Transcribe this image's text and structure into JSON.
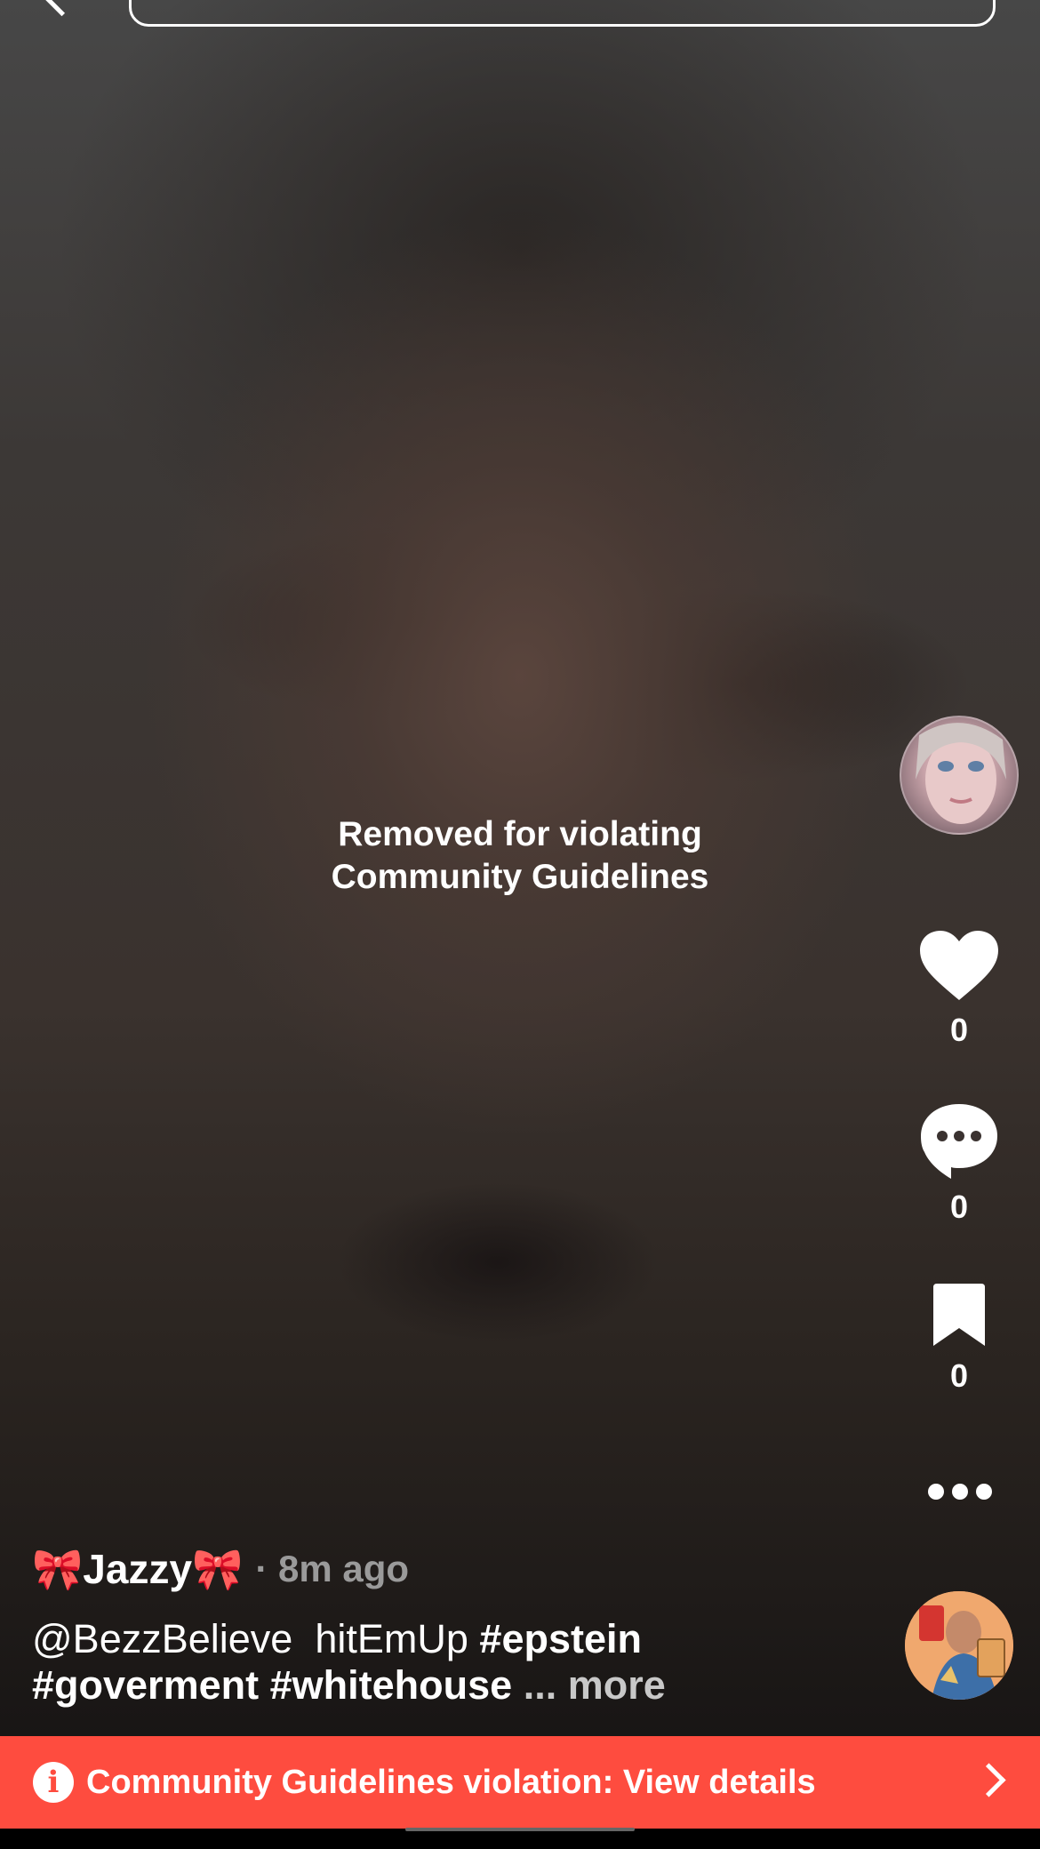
{
  "removed_notice": {
    "line1": "Removed for violating",
    "line2": "Community Guidelines"
  },
  "side_rail": {
    "like_count": "0",
    "comment_count": "0",
    "bookmark_count": "0"
  },
  "post": {
    "username": "🎀Jazzy🎀",
    "timestamp": "· 8m ago",
    "caption": {
      "mention": "@BezzBelieve",
      "text": "hitEmUp",
      "tag1": "#epstein",
      "tag2": "#goverment",
      "tag3": "#whitehouse",
      "ellipsis": "...",
      "more": "more"
    }
  },
  "violation_banner": {
    "text": "Community Guidelines violation: View details"
  },
  "colors": {
    "banner": "#fe4c3f"
  },
  "icons": [
    "back-icon",
    "search-icon",
    "heart-icon",
    "comment-icon",
    "bookmark-icon",
    "more-icon",
    "info-icon",
    "chevron-right-icon"
  ]
}
